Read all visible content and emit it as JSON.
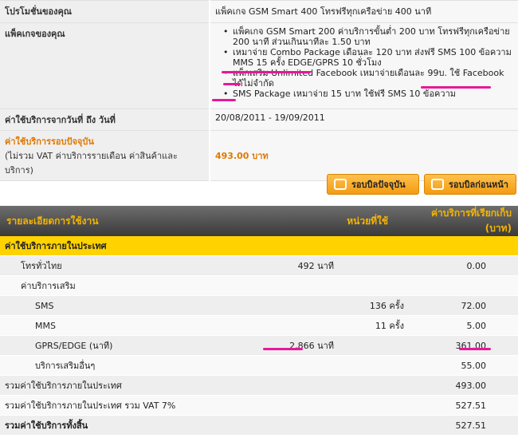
{
  "info": {
    "promo_label": "โปรโมชั่นของคุณ",
    "promo_value": "แพ็คเกจ GSM Smart 400 โทรฟรีทุกเครือข่าย 400 นาที",
    "packages_label": "แพ็คเกจของคุณ",
    "packages": [
      "แพ็คเกจ GSM Smart 200 ค่าบริการขั้นต่ำ 200 บาท โทรฟรีทุกเครือข่าย 200 นาที ส่วนเกินนาทีละ 1.50 บาท",
      "เหมาจ่าย Combo Package เดือนละ 120 บาท ส่งฟรี SMS 100 ข้อความ MMS 15 ครั้ง EDGE/GPRS 10 ชั่วโมง",
      "แพ็กเสริม Unlimited Facebook เหมาจ่ายเดือนละ 99บ. ใช้ Facebook ได้ไม่จำกัด",
      "SMS Package เหมาจ่าย 15 บาท ใช้ฟรี SMS 10 ข้อความ"
    ],
    "period_label": "ค่าใช้บริการจากวันที่ ถึง วันที่",
    "period_value": "20/08/2011 - 19/09/2011",
    "current_label": "ค่าใช้บริการรอบปัจจุบัน",
    "current_note": "(ไม่รวม VAT ค่าบริการรายเดือน ค่าสินค้าและบริการ)",
    "current_value": "493.00 บาท"
  },
  "buttons": {
    "current_bill": "รอบบิลปัจจุบัน",
    "previous_bill": "รอบบิลก่อนหน้า"
  },
  "table": {
    "headers": [
      "รายละเอียดการใช้งาน",
      "หน่วยที่ใช้",
      "ค่าบริการที่เรียกเก็บ (บาท)"
    ],
    "section": "ค่าใช้บริการภายในประเทศ",
    "rows": [
      {
        "name": "โทรทั่วไทย",
        "unit1": "492 นาที",
        "unit2": "",
        "amount": "0.00"
      },
      {
        "name": "ค่าบริการเสริม",
        "unit1": "",
        "unit2": "",
        "amount": ""
      },
      {
        "name": "SMS",
        "unit1": "",
        "unit2": "136 ครั้ง",
        "amount": "72.00"
      },
      {
        "name": "MMS",
        "unit1": "",
        "unit2": "11 ครั้ง",
        "amount": "5.00"
      },
      {
        "name": "GPRS/EDGE (นาที)",
        "unit1": "2,866 นาที",
        "unit2": "",
        "amount": "361.00"
      },
      {
        "name": "บริการเสริมอื่นๆ",
        "unit1": "",
        "unit2": "",
        "amount": "55.00"
      }
    ],
    "totals": [
      {
        "name": "รวมค่าใช้บริการภายในประเทศ",
        "amount": "493.00"
      },
      {
        "name": "รวมค่าใช้บริการภายในประเทศ รวม VAT 7%",
        "amount": "527.51"
      },
      {
        "name": "รวมค่าใช้บริการทั้งสิ้น",
        "amount": "527.51"
      }
    ]
  }
}
